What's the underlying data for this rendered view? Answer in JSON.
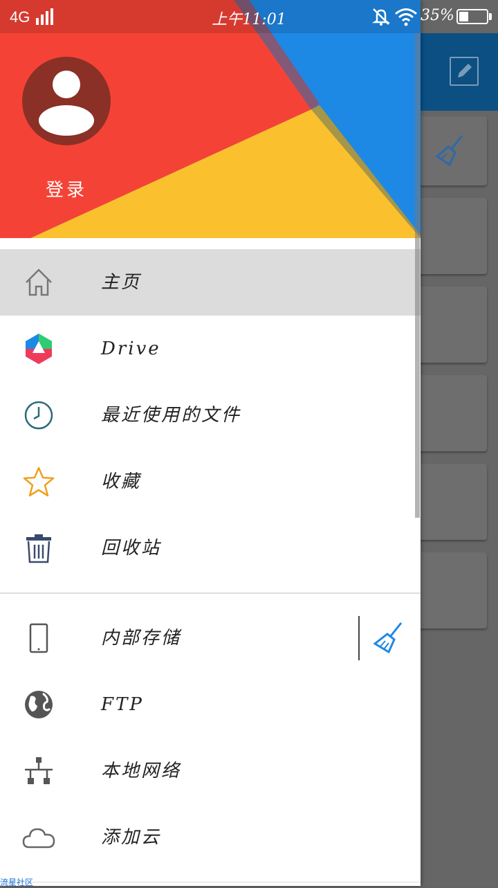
{
  "status_bar": {
    "network": "4G",
    "time": "上午11:01",
    "battery_percent": "35%",
    "battery_level": 0.35
  },
  "drawer": {
    "login_label": "登录",
    "items_primary": [
      {
        "label": "主页",
        "icon": "home-icon"
      },
      {
        "label": "Drive",
        "icon": "drive-icon"
      },
      {
        "label": "最近使用的文件",
        "icon": "clock-icon"
      },
      {
        "label": "收藏",
        "icon": "star-icon"
      },
      {
        "label": "回收站",
        "icon": "trash-icon"
      }
    ],
    "items_storage": [
      {
        "label": "内部存储",
        "icon": "phone-icon"
      },
      {
        "label": "FTP",
        "icon": "globe-icon"
      },
      {
        "label": "本地网络",
        "icon": "network-icon"
      },
      {
        "label": "添加云",
        "icon": "cloud-icon"
      }
    ]
  },
  "colors": {
    "header_red": "#f44336",
    "header_blue": "#1e88e5",
    "header_yellow": "#fbc02d",
    "accent_blue": "#1e88e5"
  },
  "watermark": "流星社区"
}
